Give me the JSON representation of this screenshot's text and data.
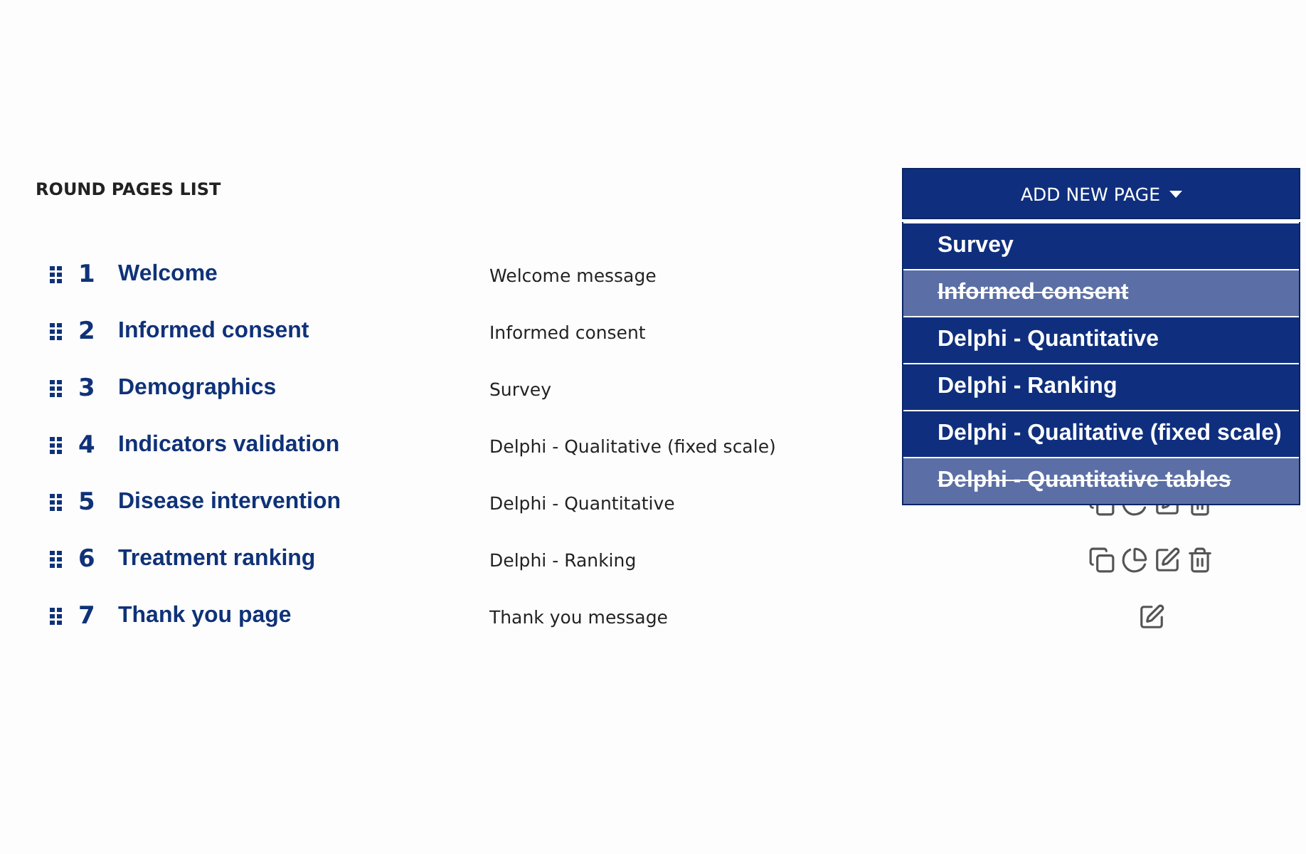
{
  "title": "ROUND PAGES LIST",
  "rows": [
    {
      "number": "1",
      "name": "Welcome",
      "type": "Welcome message",
      "actions": []
    },
    {
      "number": "2",
      "name": "Informed consent",
      "type": "Informed consent",
      "actions": []
    },
    {
      "number": "3",
      "name": "Demographics",
      "type": "Survey",
      "actions": []
    },
    {
      "number": "4",
      "name": "Indicators validation",
      "type": "Delphi - Qualitative (fixed scale)",
      "actions": []
    },
    {
      "number": "5",
      "name": "Disease intervention",
      "type": "Delphi - Quantitative",
      "actions": [
        {
          "kind": "copy"
        },
        {
          "kind": "chart"
        },
        {
          "kind": "edit"
        },
        {
          "kind": "delete"
        }
      ]
    },
    {
      "number": "6",
      "name": "Treatment ranking",
      "type": "Delphi - Ranking",
      "actions": [
        {
          "kind": "copy"
        },
        {
          "kind": "chart"
        },
        {
          "kind": "edit"
        },
        {
          "kind": "delete"
        }
      ]
    },
    {
      "number": "7",
      "name": "Thank you page",
      "type": "Thank you message",
      "actions": [
        {
          "kind": "edit"
        }
      ]
    }
  ],
  "add_button": {
    "label": "ADD NEW PAGE",
    "expanded": true
  },
  "menu": [
    {
      "label": "Survey",
      "disabled": false
    },
    {
      "label": "Informed consent",
      "disabled": true
    },
    {
      "label": "Delphi - Quantitative",
      "disabled": false
    },
    {
      "label": "Delphi - Ranking",
      "disabled": false
    },
    {
      "label": "Delphi - Qualitative (fixed scale)",
      "disabled": false
    },
    {
      "label": "Delphi - Quantitative tables",
      "disabled": true
    }
  ]
}
